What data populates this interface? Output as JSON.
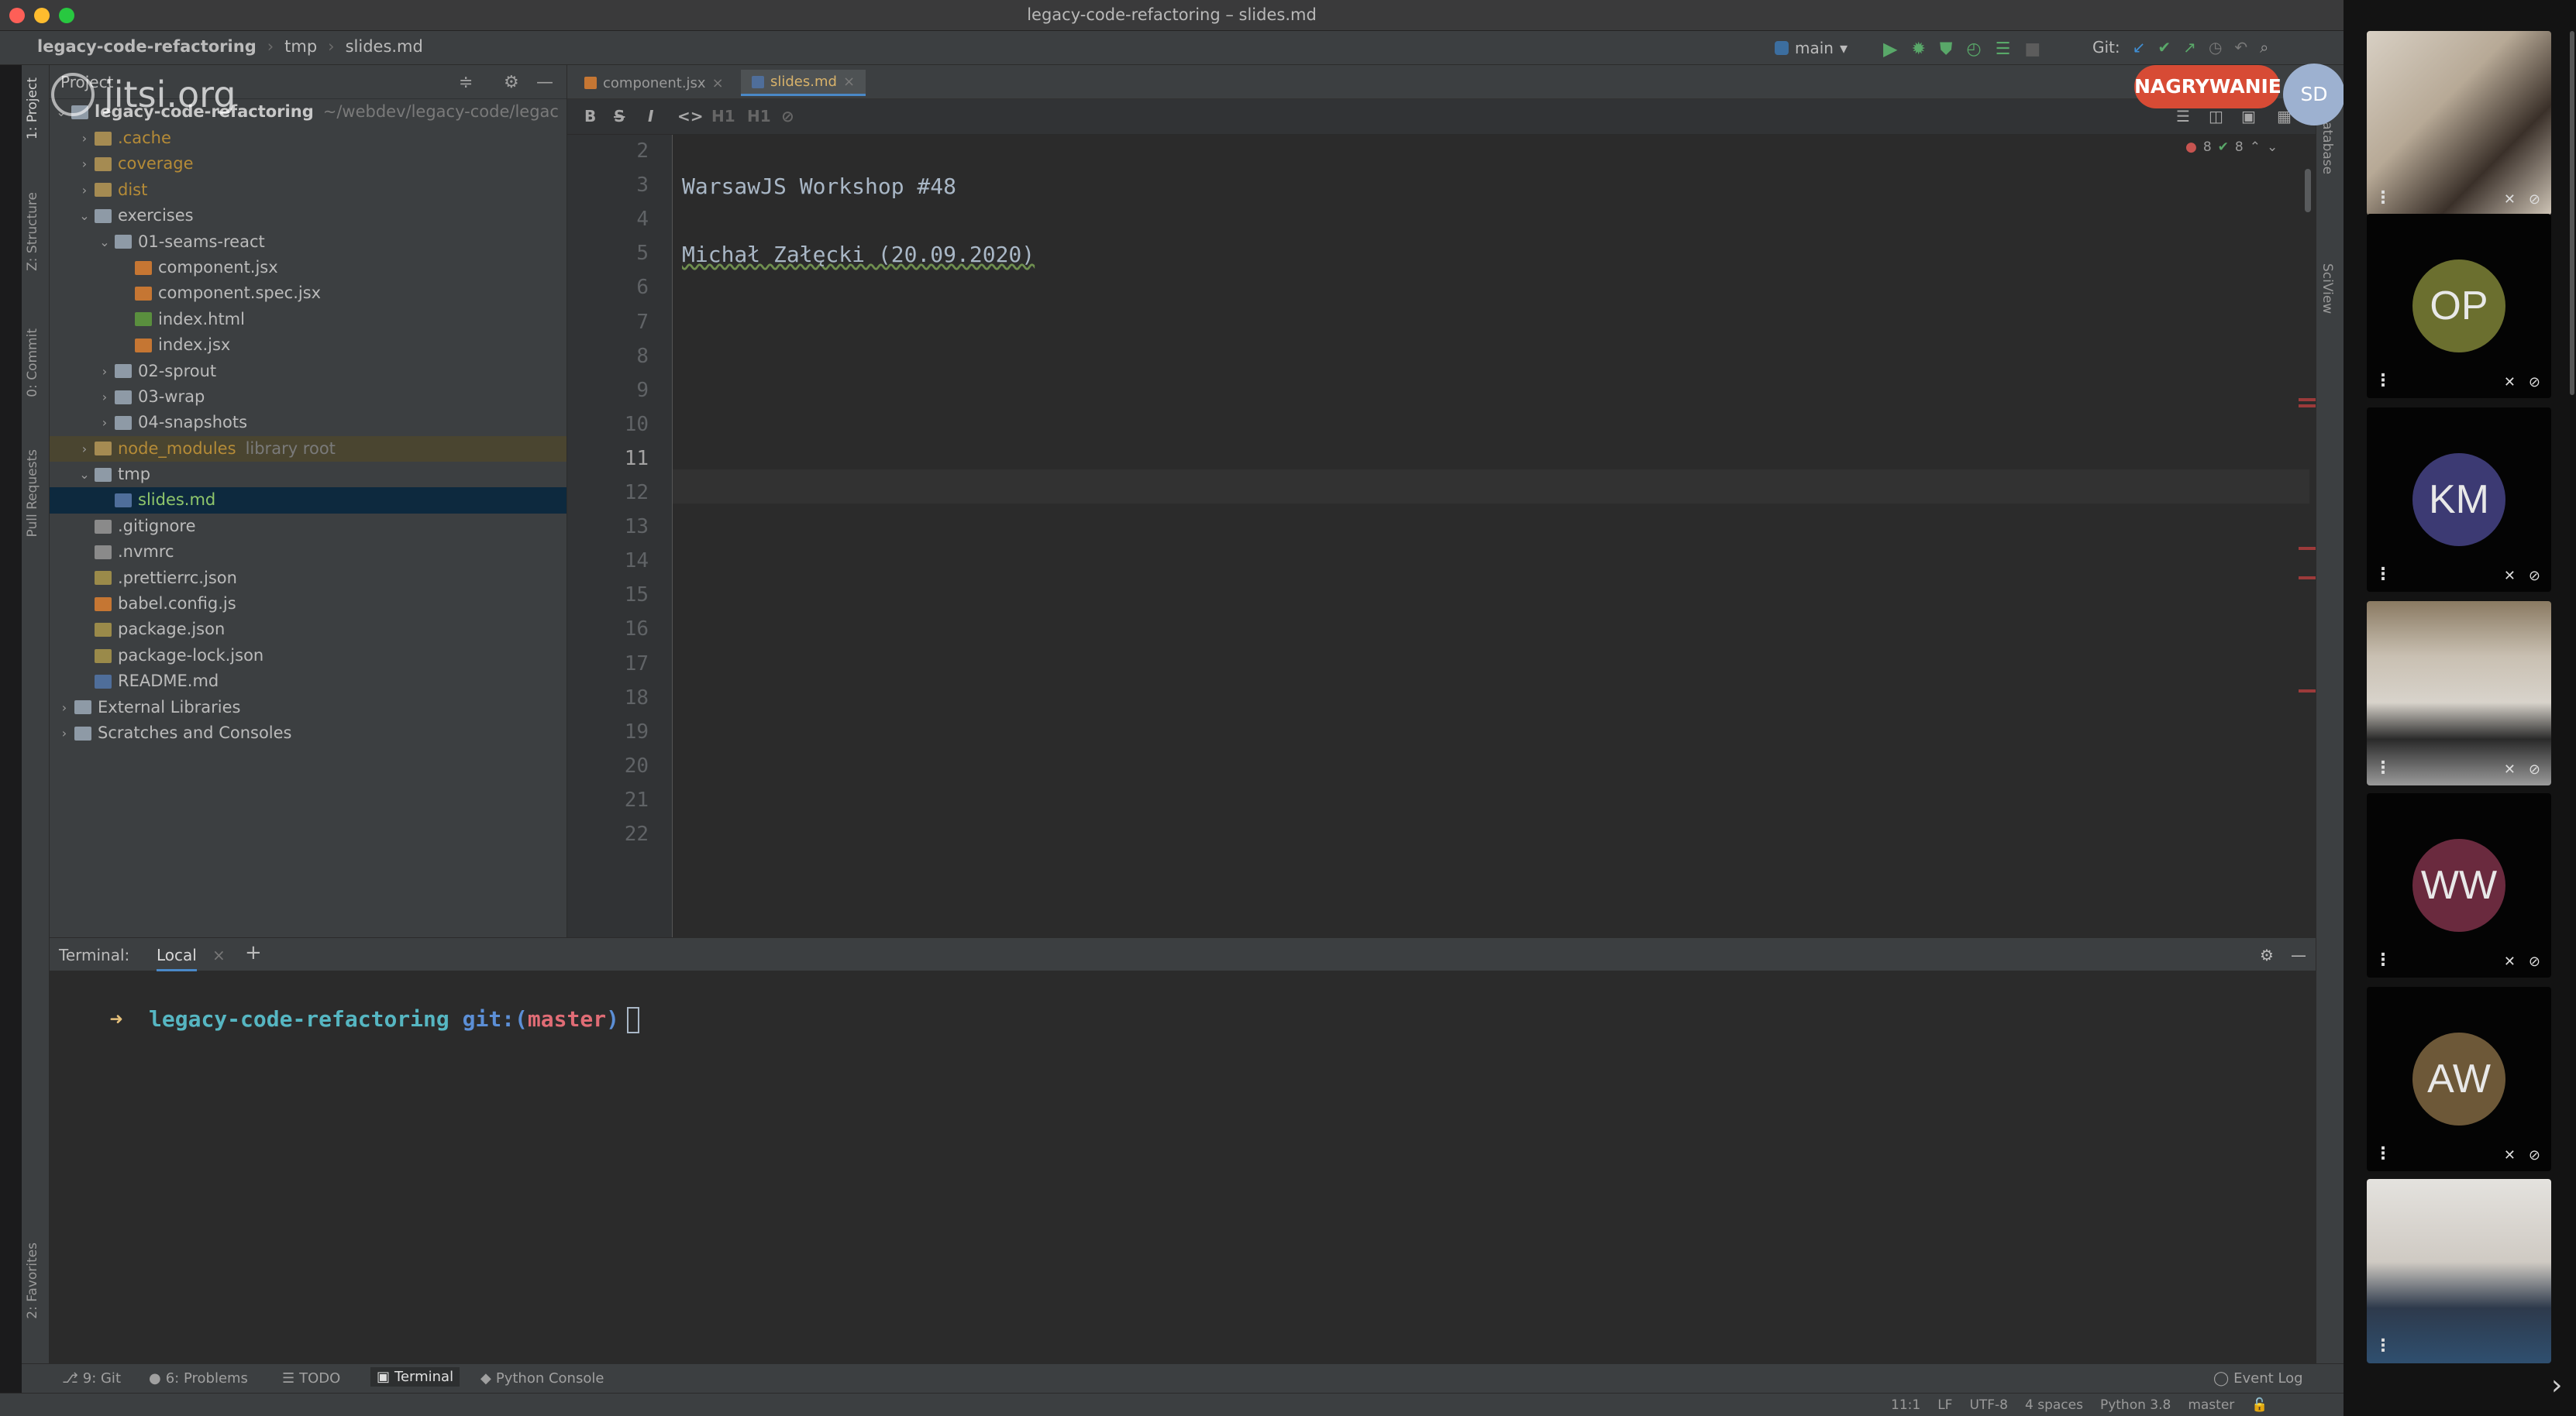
{
  "window": {
    "title": "legacy-code-refactoring – slides.md",
    "traffic_lights": {
      "close": "#fe5f57",
      "minimize": "#febc2e",
      "zoom": "#28c840"
    }
  },
  "navbar": {
    "breadcrumbs": [
      "legacy-code-refactoring",
      "tmp",
      "slides.md"
    ],
    "run_config": "main",
    "git_label": "Git:"
  },
  "left_strip": {
    "tabs": [
      "1: Project",
      "Z: Structure",
      "0: Commit",
      "Pull Requests",
      "2: Favorites"
    ]
  },
  "right_strip": {
    "tabs": [
      "Database",
      "SciView"
    ]
  },
  "project": {
    "header_label": "Project",
    "root_label": "legacy-code-refactoring",
    "root_path": "~/webdev/legacy-code/legac",
    "tree": [
      {
        "label": ".cache",
        "kind": "folder-ex",
        "depth": 1,
        "arrow": "right"
      },
      {
        "label": "coverage",
        "kind": "folder-ex",
        "depth": 1,
        "arrow": "right"
      },
      {
        "label": "dist",
        "kind": "folder-ex",
        "depth": 1,
        "arrow": "right"
      },
      {
        "label": "exercises",
        "kind": "folder",
        "depth": 1,
        "arrow": "down"
      },
      {
        "label": "01-seams-react",
        "kind": "folder",
        "depth": 2,
        "arrow": "down"
      },
      {
        "label": "component.jsx",
        "kind": "js",
        "depth": 3,
        "arrow": ""
      },
      {
        "label": "component.spec.jsx",
        "kind": "js",
        "depth": 3,
        "arrow": ""
      },
      {
        "label": "index.html",
        "kind": "html",
        "depth": 3,
        "arrow": ""
      },
      {
        "label": "index.jsx",
        "kind": "js",
        "depth": 3,
        "arrow": ""
      },
      {
        "label": "02-sprout",
        "kind": "folder",
        "depth": 2,
        "arrow": "right"
      },
      {
        "label": "03-wrap",
        "kind": "folder",
        "depth": 2,
        "arrow": "right"
      },
      {
        "label": "04-snapshots",
        "kind": "folder",
        "depth": 2,
        "arrow": "right"
      },
      {
        "label": "node_modules",
        "suffix": "library root",
        "kind": "folder-ex",
        "depth": 1,
        "arrow": "right",
        "state": "library"
      },
      {
        "label": "tmp",
        "kind": "folder",
        "depth": 1,
        "arrow": "down"
      },
      {
        "label": "slides.md",
        "kind": "md",
        "depth": 2,
        "arrow": "",
        "state": "selected"
      },
      {
        "label": ".gitignore",
        "kind": "git",
        "depth": 1,
        "arrow": ""
      },
      {
        "label": ".nvmrc",
        "kind": "git",
        "depth": 1,
        "arrow": ""
      },
      {
        "label": ".prettierrc.json",
        "kind": "json",
        "depth": 1,
        "arrow": ""
      },
      {
        "label": "babel.config.js",
        "kind": "js",
        "depth": 1,
        "arrow": ""
      },
      {
        "label": "package.json",
        "kind": "json",
        "depth": 1,
        "arrow": ""
      },
      {
        "label": "package-lock.json",
        "kind": "json",
        "depth": 1,
        "arrow": ""
      },
      {
        "label": "README.md",
        "kind": "md",
        "depth": 1,
        "arrow": ""
      },
      {
        "label": "External Libraries",
        "kind": "lib",
        "depth": 0,
        "arrow": "right"
      },
      {
        "label": "Scratches and Consoles",
        "kind": "lib",
        "depth": 0,
        "arrow": "right"
      }
    ]
  },
  "editor": {
    "tabs": [
      {
        "label": "component.jsx",
        "active": false
      },
      {
        "label": "slides.md",
        "active": true
      }
    ],
    "md_toolbar": [
      "B",
      "S",
      "I",
      "<>",
      "H1",
      "H1"
    ],
    "inspection_counts": {
      "errors": "8",
      "ok": "8"
    },
    "current_line": 11,
    "lines": [
      {
        "n": 2,
        "text": ""
      },
      {
        "n": 3,
        "text": "WarsawJS Workshop #48"
      },
      {
        "n": 4,
        "text": ""
      },
      {
        "n": 5,
        "text": "Michał Załęcki (20.09.2020)"
      },
      {
        "n": 6,
        "text": ""
      },
      {
        "n": 7,
        "text": ""
      },
      {
        "n": 8,
        "text": ""
      },
      {
        "n": 9,
        "text": ""
      },
      {
        "n": 10,
        "text": ""
      },
      {
        "n": 11,
        "text": ""
      },
      {
        "n": 12,
        "text": ""
      },
      {
        "n": 13,
        "text": ""
      },
      {
        "n": 14,
        "text": ""
      },
      {
        "n": 15,
        "text": ""
      },
      {
        "n": 16,
        "text": ""
      },
      {
        "n": 17,
        "text": ""
      },
      {
        "n": 18,
        "text": ""
      },
      {
        "n": 19,
        "text": ""
      },
      {
        "n": 20,
        "text": ""
      },
      {
        "n": 21,
        "text": ""
      },
      {
        "n": 22,
        "text": ""
      }
    ]
  },
  "terminal": {
    "label": "Terminal:",
    "tab": "Local",
    "prompt_arrow": "➜",
    "prompt_dir": "legacy-code-refactoring",
    "prompt_git": "git:(",
    "prompt_branch": "master",
    "prompt_close": ")"
  },
  "tool_windows": [
    {
      "label": "9: Git",
      "active": false
    },
    {
      "label": "6: Problems",
      "active": false
    },
    {
      "label": "TODO",
      "active": false
    },
    {
      "label": "Terminal",
      "active": true
    },
    {
      "label": "Python Console",
      "active": false
    }
  ],
  "event_log": "Event Log",
  "status": [
    "11:1",
    "LF",
    "UTF-8",
    "4 spaces",
    "Python 3.8",
    "master"
  ],
  "jitsi": {
    "logo_text": "jitsi.org",
    "recording_label": "NAGRYWANIE",
    "self_initials": "SD",
    "participants": [
      {
        "kind": "video",
        "name": "participant-1"
      },
      {
        "kind": "avatar",
        "initials": "OP",
        "color": "#6b6f2f"
      },
      {
        "kind": "avatar",
        "initials": "KM",
        "color": "#3c3a73"
      },
      {
        "kind": "video",
        "name": "participant-4"
      },
      {
        "kind": "avatar",
        "initials": "WW",
        "color": "#6a2a3e"
      },
      {
        "kind": "avatar",
        "initials": "AW",
        "color": "#6d5838"
      },
      {
        "kind": "video",
        "name": "participant-7"
      }
    ]
  }
}
